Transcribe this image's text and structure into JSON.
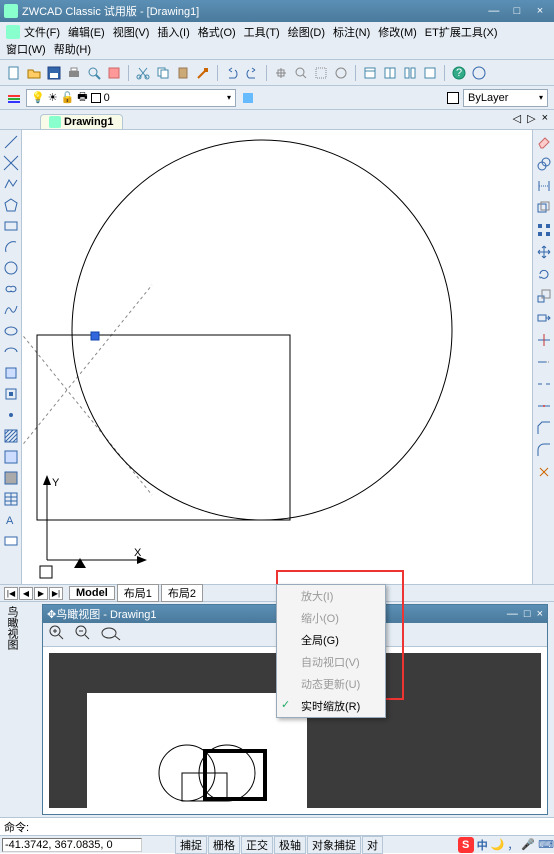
{
  "title": "ZWCAD Classic 试用版 - [Drawing1]",
  "menus": [
    "文件(F)",
    "编辑(E)",
    "视图(V)",
    "插入(I)",
    "格式(O)",
    "工具(T)",
    "绘图(D)",
    "标注(N)",
    "修改(M)",
    "ET扩展工具(X)",
    "窗口(W)",
    "帮助(H)"
  ],
  "layer_name": "0",
  "bylayer": "ByLayer",
  "doc_tab": "Drawing1",
  "tab_controls": [
    "◁",
    "▷",
    "×"
  ],
  "axis": {
    "x": "X",
    "y": "Y"
  },
  "sheet_nav": [
    "|◀",
    "◀",
    "▶",
    "▶|"
  ],
  "sheets": [
    "Model",
    "布局1",
    "布局2"
  ],
  "aerial_title": "鸟瞰视图 - Drawing1",
  "aerial_wb": [
    "—",
    "□",
    "×"
  ],
  "context_menu": [
    {
      "label": "放大(I)",
      "disabled": true,
      "checked": false
    },
    {
      "label": "缩小(O)",
      "disabled": true,
      "checked": false
    },
    {
      "label": "全局(G)",
      "disabled": false,
      "checked": false
    },
    {
      "label": "自动视口(V)",
      "disabled": true,
      "checked": false
    },
    {
      "label": "动态更新(U)",
      "disabled": true,
      "checked": false
    },
    {
      "label": "实时缩放(R)",
      "disabled": false,
      "checked": true
    }
  ],
  "side_label": "鸟瞰视图",
  "cmd_prompt": "命令:",
  "coords": "-41.3742, 367.0835, 0",
  "status_btns": [
    "捕捉",
    "栅格",
    "正交",
    "极轴",
    "对象捕捉",
    "对"
  ],
  "ime": "中"
}
